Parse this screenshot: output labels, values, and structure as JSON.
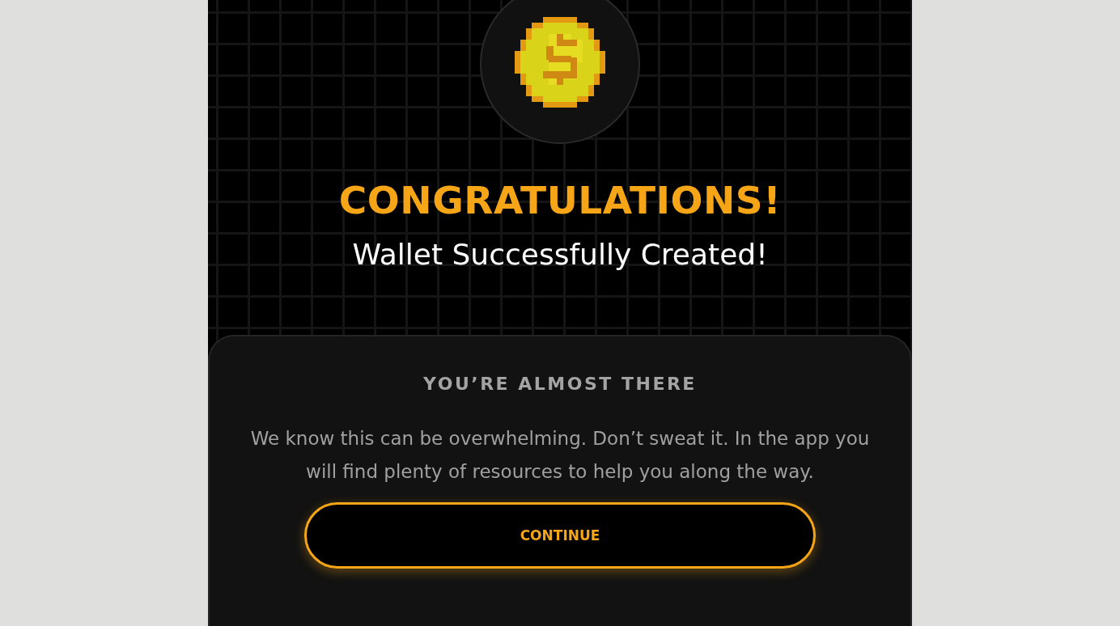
{
  "heading": "CONGRATULATIONS!",
  "subtitle": "Wallet Successfully Created!",
  "card": {
    "title": "YOU’RE ALMOST THERE",
    "message": "We know this can be overwhelming. Don’t sweat it. In the app you will find plenty of resources to help you along the way.",
    "button": "CONTINUE"
  }
}
